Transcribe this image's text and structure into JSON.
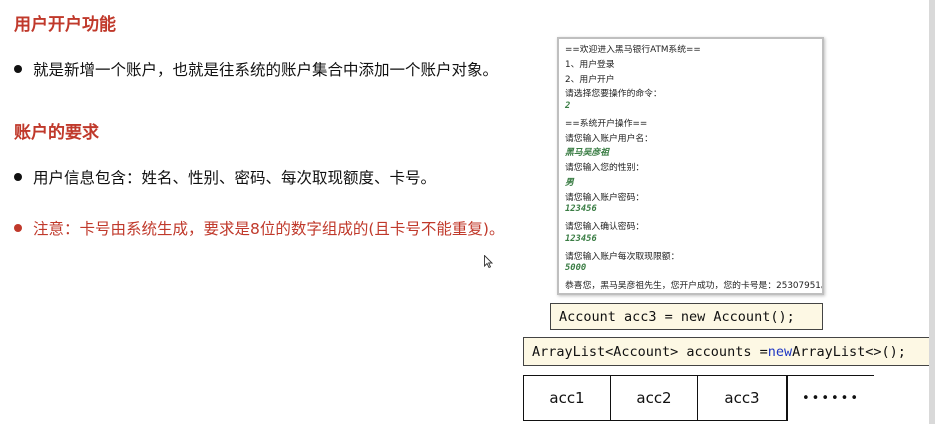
{
  "heading1": "用户开户功能",
  "bullet1": "就是新增一个账户，也就是往系统的账户集合中添加一个账户对象。",
  "heading2": "账户的要求",
  "bullet2": "用户信息包含：姓名、性别、密码、每次取现额度、卡号。",
  "bullet3": "注意：卡号由系统生成，要求是8位的数字组成的(且卡号不能重复)。",
  "console": {
    "lines": [
      {
        "text": "==欢迎进入黑马银行ATM系统==",
        "input": false
      },
      {
        "text": "1、用户登录",
        "input": false
      },
      {
        "text": "2、用户开户",
        "input": false
      },
      {
        "text": "请选择您要操作的命令：",
        "input": false
      },
      {
        "text": "2",
        "input": true
      },
      {
        "text": "==系统开户操作==",
        "input": false
      },
      {
        "text": "请您输入账户用户名：",
        "input": false
      },
      {
        "text": "黑马吴彦祖",
        "input": true
      },
      {
        "text": "请您输入您的性别：",
        "input": false
      },
      {
        "text": "男",
        "input": true
      },
      {
        "text": "请您输入账户密码：",
        "input": false
      },
      {
        "text": "123456",
        "input": true
      },
      {
        "text": "请您输入确认密码：",
        "input": false
      },
      {
        "text": "123456",
        "input": true
      },
      {
        "text": "请您输入账户每次取现限额：",
        "input": false
      },
      {
        "text": "5000",
        "input": true
      },
      {
        "text": "恭喜您，黑马吴彦祖先生，您开户成功，您的卡号是：25307951。",
        "input": false
      }
    ]
  },
  "code1": "Account acc3 = new Account();",
  "code2": {
    "before": "ArrayList<Account> accounts = ",
    "keyword": "new",
    "after": " ArrayList<>();"
  },
  "cells": [
    "acc1",
    "acc2",
    "acc3",
    "••••••"
  ],
  "colors": {
    "heading": "#c0392b",
    "input": "#3a7d44",
    "keyword": "#1f37c4",
    "code_bg": "#fdf8e4"
  }
}
